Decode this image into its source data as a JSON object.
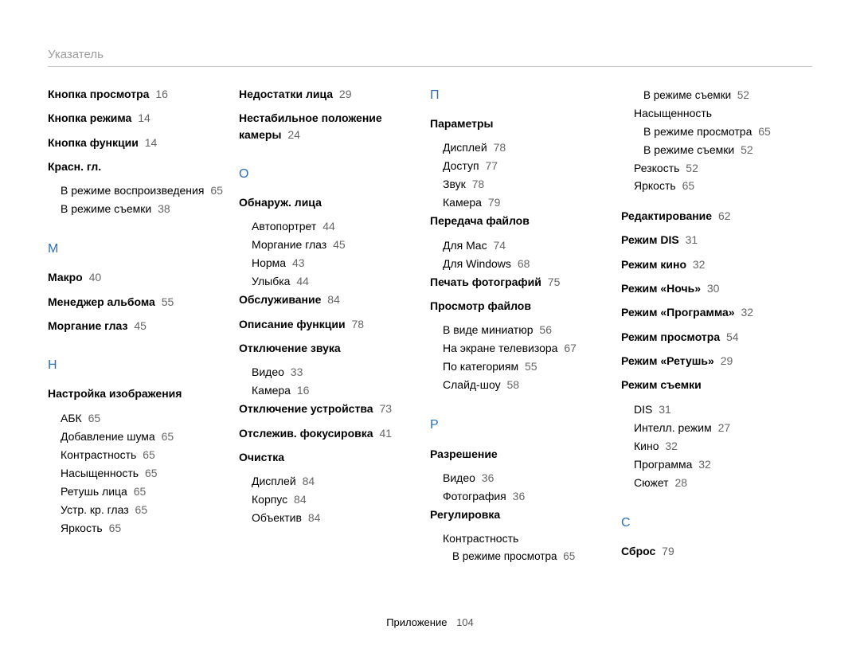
{
  "header": {
    "title": "Указатель"
  },
  "footer": {
    "label": "Приложение",
    "page": "104"
  },
  "columns": [
    {
      "groups": [
        {
          "entries": [
            {
              "label": "Кнопка просмотра",
              "page": "16"
            },
            {
              "label": "Кнопка режима",
              "page": "14"
            },
            {
              "label": "Кнопка функции",
              "page": "14"
            },
            {
              "label": "Красн. гл.",
              "subs": [
                {
                  "label": "В режиме воспроизведения",
                  "page": "65"
                },
                {
                  "label": "В режиме съемки",
                  "page": "38"
                }
              ]
            }
          ]
        },
        {
          "letter": "М",
          "entries": [
            {
              "label": "Макро",
              "page": "40"
            },
            {
              "label": "Менеджер альбома",
              "page": "55"
            },
            {
              "label": "Моргание глаз",
              "page": "45"
            }
          ]
        },
        {
          "letter": "Н",
          "entries": [
            {
              "label": "Настройка изображения",
              "subs": [
                {
                  "label": "АБК",
                  "page": "65"
                },
                {
                  "label": "Добавление шума",
                  "page": "65"
                },
                {
                  "label": "Контрастность",
                  "page": "65"
                },
                {
                  "label": "Насыщенность",
                  "page": "65"
                },
                {
                  "label": "Ретушь лица",
                  "page": "65"
                },
                {
                  "label": "Устр. кр. глаз",
                  "page": "65"
                },
                {
                  "label": "Яркость",
                  "page": "65"
                }
              ]
            }
          ]
        }
      ]
    },
    {
      "groups": [
        {
          "entries": [
            {
              "label": "Недостатки лица",
              "page": "29"
            },
            {
              "label": "Нестабильное положение камеры",
              "page": "24"
            }
          ]
        },
        {
          "letter": "О",
          "entries": [
            {
              "label": "Обнаруж. лица",
              "subs": [
                {
                  "label": "Автопортрет",
                  "page": "44"
                },
                {
                  "label": "Моргание глаз",
                  "page": "45"
                },
                {
                  "label": "Норма",
                  "page": "43"
                },
                {
                  "label": "Улыбка",
                  "page": "44"
                }
              ]
            },
            {
              "label": "Обслуживание",
              "page": "84"
            },
            {
              "label": "Описание функции",
              "page": "78"
            },
            {
              "label": "Отключение звука",
              "subs": [
                {
                  "label": "Видео",
                  "page": "33"
                },
                {
                  "label": "Камера",
                  "page": "16"
                }
              ]
            },
            {
              "label": "Отключение устройства",
              "page": "73"
            },
            {
              "label": "Отслежив. фокусировка",
              "page": "41"
            },
            {
              "label": "Очистка",
              "subs": [
                {
                  "label": "Дисплей",
                  "page": "84"
                },
                {
                  "label": "Корпус",
                  "page": "84"
                },
                {
                  "label": "Объектив",
                  "page": "84"
                }
              ]
            }
          ]
        }
      ]
    },
    {
      "groups": [
        {
          "letter": "П",
          "first": true,
          "entries": [
            {
              "label": "Параметры",
              "subs": [
                {
                  "label": "Дисплей",
                  "page": "78"
                },
                {
                  "label": "Доступ",
                  "page": "77"
                },
                {
                  "label": "Звук",
                  "page": "78"
                },
                {
                  "label": "Камера",
                  "page": "79"
                }
              ]
            },
            {
              "label": "Передача файлов",
              "subs": [
                {
                  "label": "Для Mac",
                  "page": "74"
                },
                {
                  "label": "Для Windows",
                  "page": "68"
                }
              ]
            },
            {
              "label": "Печать фотографий",
              "page": "75"
            },
            {
              "label": "Просмотр файлов",
              "subs": [
                {
                  "label": "В виде миниатюр",
                  "page": "56"
                },
                {
                  "label": "На экране телевизора",
                  "page": "67"
                },
                {
                  "label": "По категориям",
                  "page": "55"
                },
                {
                  "label": "Слайд-шоу",
                  "page": "58"
                }
              ]
            }
          ]
        },
        {
          "letter": "Р",
          "entries": [
            {
              "label": "Разрешение",
              "subs": [
                {
                  "label": "Видео",
                  "page": "36"
                },
                {
                  "label": "Фотография",
                  "page": "36"
                }
              ]
            },
            {
              "label": "Регулировка",
              "subs": [
                {
                  "label": "Контрастность",
                  "subsub": [
                    {
                      "label": "В режиме просмотра",
                      "page": "65"
                    }
                  ]
                }
              ]
            }
          ]
        }
      ]
    },
    {
      "groups": [
        {
          "preSubs": [
            {
              "label": "В режиме съемки",
              "page": "52",
              "subsub": true
            }
          ],
          "entries": [
            {
              "labelPlain": "Насыщенность",
              "subs": [
                {
                  "label": "В режиме просмотра",
                  "page": "65"
                },
                {
                  "label": "В режиме съемки",
                  "page": "52"
                }
              ]
            },
            {
              "labelPlain": "Резкость",
              "page": "52"
            },
            {
              "labelPlain": "Яркость",
              "page": "65"
            },
            {
              "label": "Редактирование",
              "page": "62",
              "topmargin": true
            },
            {
              "label": "Режим DIS",
              "page": "31"
            },
            {
              "label": "Режим кино",
              "page": "32"
            },
            {
              "label": "Режим «Ночь»",
              "page": "30"
            },
            {
              "label": "Режим «Программа»",
              "page": "32"
            },
            {
              "label": "Режим просмотра",
              "page": "54"
            },
            {
              "label": "Режим «Ретушь»",
              "page": "29"
            },
            {
              "label": "Режим съемки",
              "subs": [
                {
                  "label": "DIS",
                  "page": "31"
                },
                {
                  "label": "Интелл. режим",
                  "page": "27"
                },
                {
                  "label": "Кино",
                  "page": "32"
                },
                {
                  "label": "Программа",
                  "page": "32"
                },
                {
                  "label": "Сюжет",
                  "page": "28"
                }
              ]
            }
          ]
        },
        {
          "letter": "С",
          "entries": [
            {
              "label": "Сброс",
              "page": "79"
            }
          ]
        }
      ]
    }
  ]
}
